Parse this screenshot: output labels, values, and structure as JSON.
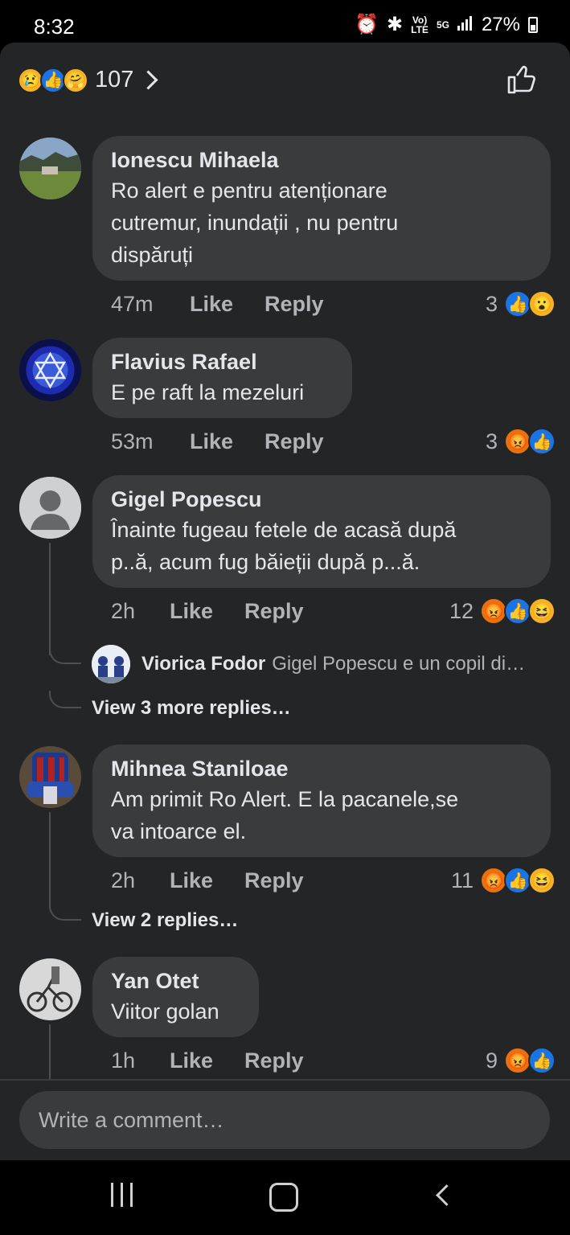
{
  "status": {
    "time": "8:32",
    "volte_top": "Vo)",
    "volte_bottom": "LTE",
    "net": "5G",
    "battery": "27%"
  },
  "reactions_header": {
    "count": "107",
    "icons": [
      "sad-emoji",
      "like-emoji",
      "care-emoji"
    ]
  },
  "comments": [
    {
      "name": "Ionescu Mihaela",
      "lines": [
        "Ro alert e pentru atenționare",
        "cutremur, inundații , nu pentru",
        "dispăruți"
      ],
      "time": "47m",
      "like": "Like",
      "reply": "Reply",
      "react_count": "3",
      "react_icons": [
        "like-emoji",
        "wow-emoji"
      ]
    },
    {
      "name": "Flavius Rafael",
      "lines": [
        "E pe raft la mezeluri"
      ],
      "time": "53m",
      "like": "Like",
      "reply": "Reply",
      "react_count": "3",
      "react_icons": [
        "angry-emoji",
        "like-emoji"
      ]
    },
    {
      "name": "Gigel Popescu",
      "lines": [
        "Înainte fugeau fetele de acasă după",
        "p..ă, acum fug băieții după p...ă."
      ],
      "time": "2h",
      "like": "Like",
      "reply": "Reply",
      "react_count": "12",
      "react_icons": [
        "angry-emoji",
        "like-emoji",
        "haha-emoji"
      ],
      "reply_preview": {
        "name": "Viorica Fodor",
        "text": "Gigel Popescu e un copil di…"
      },
      "more_replies": "View 3 more replies…"
    },
    {
      "name": "Mihnea Staniloae",
      "lines": [
        "Am primit Ro Alert. E la pacanele,se",
        "va intoarce el."
      ],
      "time": "2h",
      "like": "Like",
      "reply": "Reply",
      "react_count": "11",
      "react_icons": [
        "angry-emoji",
        "like-emoji",
        "haha-emoji"
      ],
      "more_replies": "View 2 replies…"
    },
    {
      "name": "Yan Otet",
      "lines": [
        "Viitor golan"
      ],
      "time": "1h",
      "like": "Like",
      "reply": "Reply",
      "react_count": "9",
      "react_icons": [
        "angry-emoji",
        "like-emoji"
      ]
    }
  ],
  "composer": {
    "placeholder": "Write a comment…"
  },
  "colors": {
    "sheet": "#242526",
    "bubble": "#3a3b3c",
    "like_blue": "#1b74e4",
    "angry": "#e9710f",
    "emoji_yellow": "#f7b125"
  }
}
